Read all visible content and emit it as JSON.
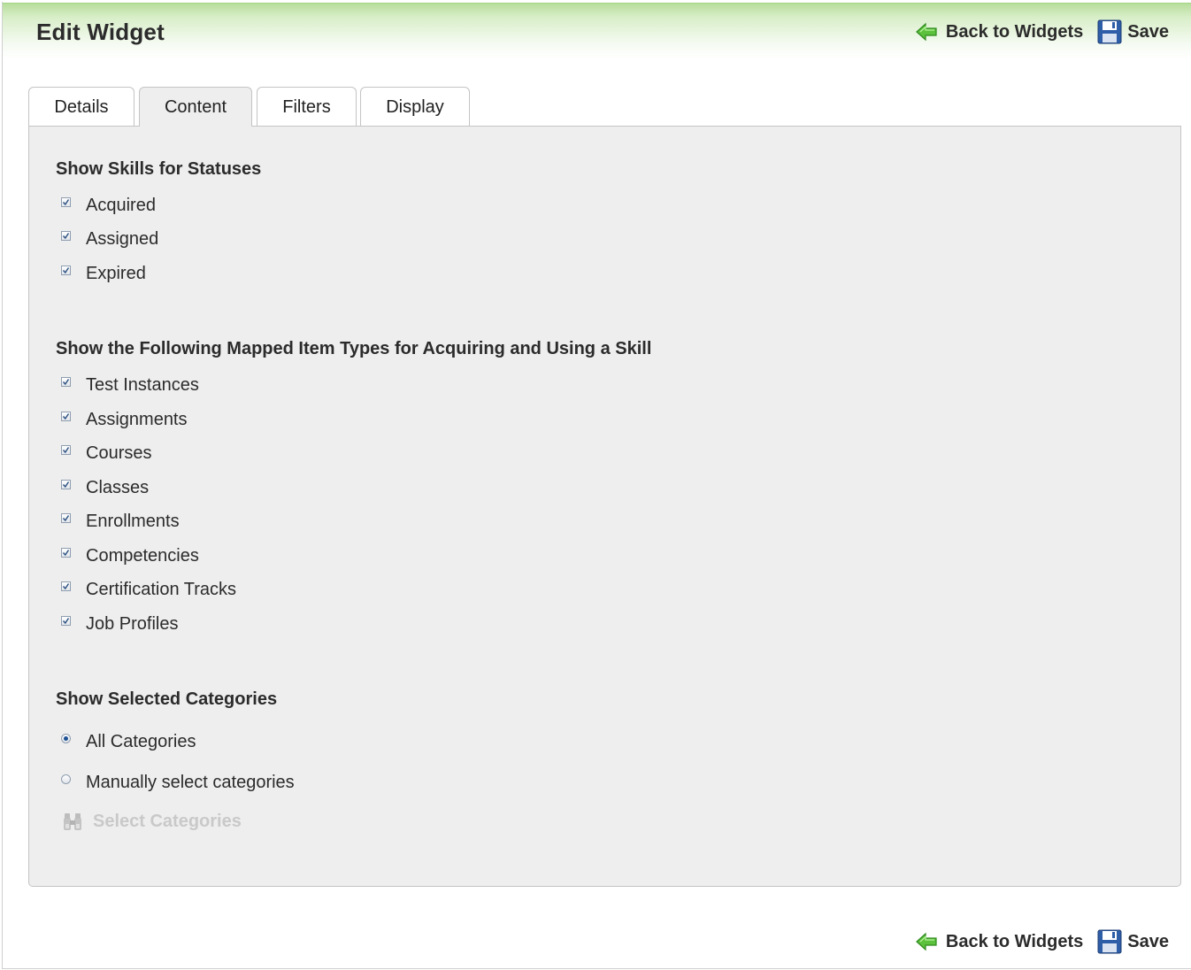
{
  "header": {
    "title": "Edit Widget",
    "back_label": "Back to Widgets",
    "save_label": "Save"
  },
  "tabs": [
    {
      "label": "Details",
      "active": false
    },
    {
      "label": "Content",
      "active": true
    },
    {
      "label": "Filters",
      "active": false
    },
    {
      "label": "Display",
      "active": false
    }
  ],
  "statuses": {
    "title": "Show Skills for Statuses",
    "items": [
      {
        "label": "Acquired",
        "checked": true
      },
      {
        "label": "Assigned",
        "checked": true
      },
      {
        "label": "Expired",
        "checked": true
      }
    ]
  },
  "item_types": {
    "title": "Show the Following Mapped Item Types for Acquiring and Using a Skill",
    "items": [
      {
        "label": "Test Instances",
        "checked": true
      },
      {
        "label": "Assignments",
        "checked": true
      },
      {
        "label": "Courses",
        "checked": true
      },
      {
        "label": "Classes",
        "checked": true
      },
      {
        "label": "Enrollments",
        "checked": true
      },
      {
        "label": "Competencies",
        "checked": true
      },
      {
        "label": "Certification Tracks",
        "checked": true
      },
      {
        "label": "Job Profiles",
        "checked": true
      }
    ]
  },
  "categories": {
    "title": "Show Selected Categories",
    "options": [
      {
        "label": "All Categories",
        "selected": true
      },
      {
        "label": "Manually select categories",
        "selected": false
      }
    ],
    "select_label": "Select Categories",
    "select_enabled": false
  },
  "footer": {
    "back_label": "Back to Widgets",
    "save_label": "Save"
  },
  "colors": {
    "header_green": "#b7dd9c",
    "panel_bg": "#eeeeee",
    "disabled_text": "#c9c9c9"
  }
}
